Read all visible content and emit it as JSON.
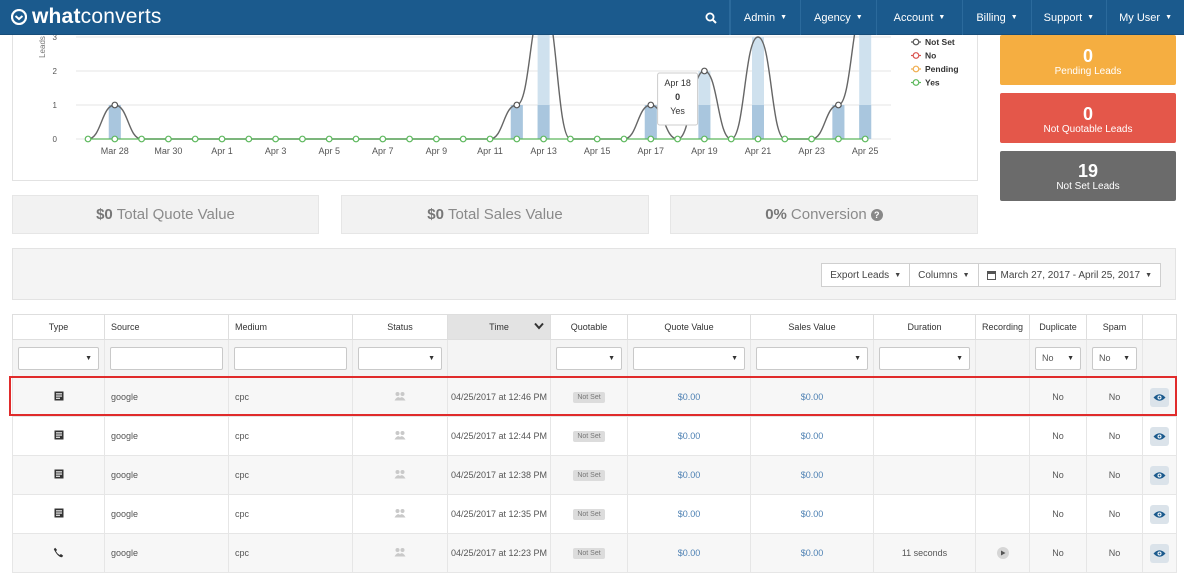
{
  "nav": {
    "logo_what": "what",
    "logo_converts": "converts",
    "items": [
      "Admin",
      "Agency",
      "Account",
      "Billing",
      "Support",
      "My User"
    ]
  },
  "chart_data": {
    "type": "line",
    "ylabel": "Leads",
    "y_ticks": [
      0,
      1,
      2,
      3
    ],
    "x_tick_labels": [
      "Mar 28",
      "Mar 30",
      "Apr 1",
      "Apr 3",
      "Apr 5",
      "Apr 7",
      "Apr 9",
      "Apr 11",
      "Apr 13",
      "Apr 15",
      "Apr 17",
      "Apr 19",
      "Apr 21",
      "Apr 23",
      "Apr 25"
    ],
    "x": [
      "Mar 27",
      "Mar 28",
      "Mar 29",
      "Mar 30",
      "Mar 31",
      "Apr 1",
      "Apr 2",
      "Apr 3",
      "Apr 4",
      "Apr 5",
      "Apr 6",
      "Apr 7",
      "Apr 8",
      "Apr 9",
      "Apr 10",
      "Apr 11",
      "Apr 12",
      "Apr 13",
      "Apr 14",
      "Apr 15",
      "Apr 16",
      "Apr 17",
      "Apr 18",
      "Apr 19",
      "Apr 20",
      "Apr 21",
      "Apr 22",
      "Apr 23",
      "Apr 24",
      "Apr 25"
    ],
    "series": [
      {
        "name": "Not Set",
        "color": "#555555",
        "values": [
          0,
          1,
          0,
          0,
          0,
          0,
          0,
          0,
          0,
          0,
          0,
          0,
          0,
          0,
          0,
          0,
          1,
          4,
          0,
          0,
          0,
          1,
          0,
          2,
          0,
          3,
          0,
          0,
          1,
          4
        ]
      },
      {
        "name": "No",
        "color": "#d9534f",
        "values": [
          0,
          0,
          0,
          0,
          0,
          0,
          0,
          0,
          0,
          0,
          0,
          0,
          0,
          0,
          0,
          0,
          0,
          0,
          0,
          0,
          0,
          0,
          0,
          0,
          0,
          0,
          0,
          0,
          0,
          0
        ]
      },
      {
        "name": "Pending",
        "color": "#f0ad4e",
        "values": [
          0,
          0,
          0,
          0,
          0,
          0,
          0,
          0,
          0,
          0,
          0,
          0,
          0,
          0,
          0,
          0,
          0,
          0,
          0,
          0,
          0,
          0,
          0,
          0,
          0,
          0,
          0,
          0,
          0,
          0
        ]
      },
      {
        "name": "Yes",
        "color": "#5cb85c",
        "values": [
          0,
          0,
          0,
          0,
          0,
          0,
          0,
          0,
          0,
          0,
          0,
          0,
          0,
          0,
          0,
          0,
          0,
          0,
          0,
          0,
          0,
          0,
          0,
          0,
          0,
          0,
          0,
          0,
          0,
          0
        ]
      }
    ],
    "tooltip": {
      "date": "Apr 18",
      "value": "0",
      "label": "Yes"
    },
    "legend_position": "top-right",
    "grid": true
  },
  "stats": {
    "pending": {
      "value": "0",
      "label": "Pending Leads"
    },
    "not_quotable": {
      "value": "0",
      "label": "Not Quotable Leads"
    },
    "not_set": {
      "value": "19",
      "label": "Not Set Leads"
    }
  },
  "summary": {
    "quote_value": "$0",
    "quote_label": "Total Quote Value",
    "sales_value": "$0",
    "sales_label": "Total Sales Value",
    "conversion_value": "0%",
    "conversion_label": "Conversion"
  },
  "toolbar": {
    "export_label": "Export Leads",
    "columns_label": "Columns",
    "date_range": "March 27, 2017 - April 25, 2017"
  },
  "table": {
    "headers": [
      "Type",
      "Source",
      "Medium",
      "Status",
      "Time",
      "Quotable",
      "Quote Value",
      "Sales Value",
      "Duration",
      "Recording",
      "Duplicate",
      "Spam"
    ],
    "filters": {
      "duplicate": "No",
      "spam": "No"
    },
    "rows": [
      {
        "type": "form",
        "source": "google",
        "medium": "cpc",
        "time": "04/25/2017 at 12:46 PM",
        "quotable": "Not Set",
        "quote_value": "$0.00",
        "sales_value": "$0.00",
        "duration": "",
        "recording": false,
        "duplicate": "No",
        "spam": "No"
      },
      {
        "type": "form",
        "source": "google",
        "medium": "cpc",
        "time": "04/25/2017 at 12:44 PM",
        "quotable": "Not Set",
        "quote_value": "$0.00",
        "sales_value": "$0.00",
        "duration": "",
        "recording": false,
        "duplicate": "No",
        "spam": "No"
      },
      {
        "type": "form",
        "source": "google",
        "medium": "cpc",
        "time": "04/25/2017 at 12:38 PM",
        "quotable": "Not Set",
        "quote_value": "$0.00",
        "sales_value": "$0.00",
        "duration": "",
        "recording": false,
        "duplicate": "No",
        "spam": "No"
      },
      {
        "type": "form",
        "source": "google",
        "medium": "cpc",
        "time": "04/25/2017 at 12:35 PM",
        "quotable": "Not Set",
        "quote_value": "$0.00",
        "sales_value": "$0.00",
        "duration": "",
        "recording": false,
        "duplicate": "No",
        "spam": "No"
      },
      {
        "type": "phone",
        "source": "google",
        "medium": "cpc",
        "time": "04/25/2017 at 12:23 PM",
        "quotable": "Not Set",
        "quote_value": "$0.00",
        "sales_value": "$0.00",
        "duration": "11 seconds",
        "recording": true,
        "duplicate": "No",
        "spam": "No"
      }
    ]
  }
}
